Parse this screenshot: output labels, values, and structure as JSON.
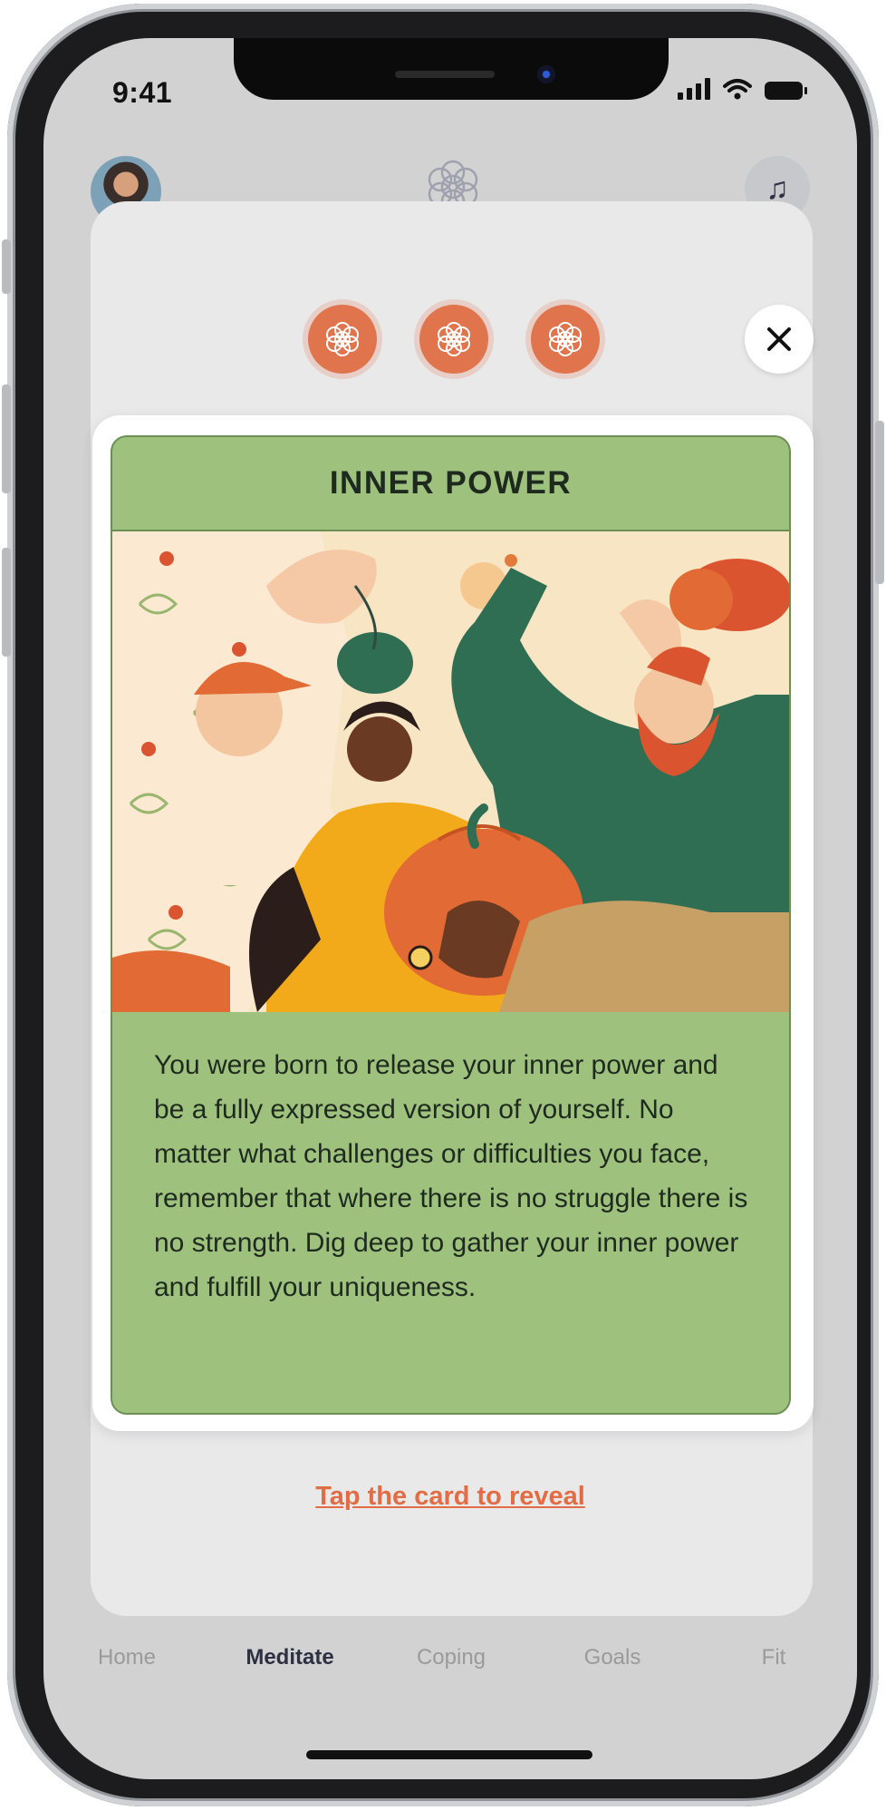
{
  "status_bar": {
    "time": "9:41"
  },
  "header": {
    "logo_icon": "mandala-logo-icon",
    "music_icon": "music-note-icon"
  },
  "modal": {
    "progress_pills": [
      "mandala-icon",
      "mandala-icon",
      "mandala-icon"
    ],
    "close_icon": "close-icon",
    "card": {
      "title": "INNER POWER",
      "body": "You were born to release your inner power and be a fully expressed version of yourself. No matter what challenges or difficulties you face, remember that where there is no struggle there is no strength. Dig deep to gather your inner power and fulfill your uniqueness."
    },
    "reveal_link": "Tap the card to reveal"
  },
  "tabbar": {
    "items": [
      {
        "label": "Home",
        "active": false
      },
      {
        "label": "Meditate",
        "active": true
      },
      {
        "label": "Coping",
        "active": false
      },
      {
        "label": "Goals",
        "active": false
      },
      {
        "label": "Fit",
        "active": false
      }
    ]
  },
  "colors": {
    "accent": "#e0744d",
    "card_green": "#9ec27e",
    "reveal_link": "#e26c44",
    "overlay": "#d2d2d2"
  }
}
